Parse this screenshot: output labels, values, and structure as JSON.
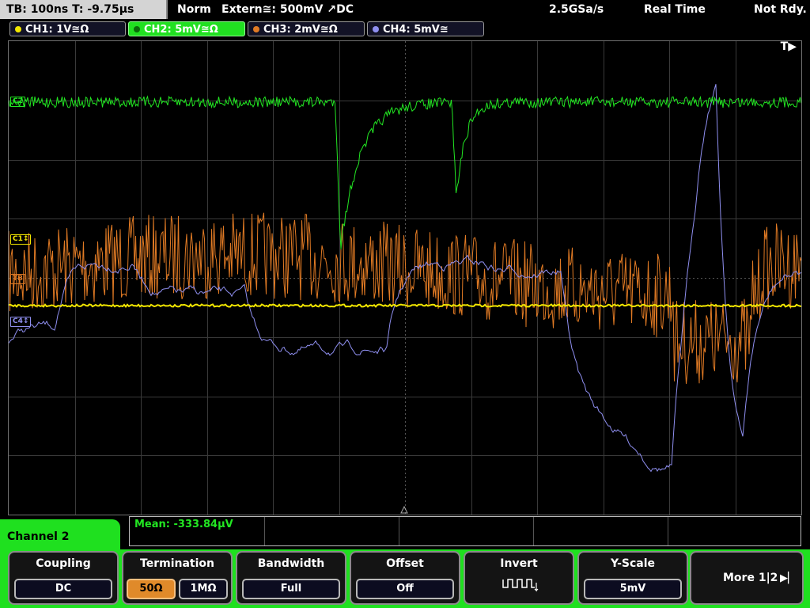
{
  "status": {
    "timebase": "TB: 100ns   T: -9.75µs",
    "trigger_mode": "Norm",
    "trigger_source": "Extern≅: 500mV ↗DC",
    "sample_rate": "2.5GSa/s",
    "acq_mode": "Real Time",
    "state": "Not Rdy."
  },
  "channels": [
    {
      "label": "CH1: 1V≅Ω",
      "color": "#f2e600"
    },
    {
      "label": "CH2: 5mV≅Ω",
      "color": "#22e622"
    },
    {
      "label": "CH3: 2mV≅Ω",
      "color": "#e07a24"
    },
    {
      "label": "CH4: 5mV≅",
      "color": "#8f8ff0"
    }
  ],
  "markers": {
    "trigger": "T",
    "ch1": "C1",
    "ch3": "TB",
    "ch4": "C4",
    "ch2": "C2"
  },
  "measurement": {
    "mean": "Mean: -333.84µV"
  },
  "menu": {
    "channel_title": "Channel 2",
    "coupling": {
      "title": "Coupling",
      "value": "DC"
    },
    "termination": {
      "title": "Termination",
      "opt1": "50Ω",
      "opt2": "1MΩ"
    },
    "bandwidth": {
      "title": "Bandwidth",
      "value": "Full"
    },
    "offset": {
      "title": "Offset",
      "value": "Off"
    },
    "invert": {
      "title": "Invert"
    },
    "yscale": {
      "title": "Y-Scale",
      "value": "5mV"
    },
    "more": "More 1|2"
  }
}
